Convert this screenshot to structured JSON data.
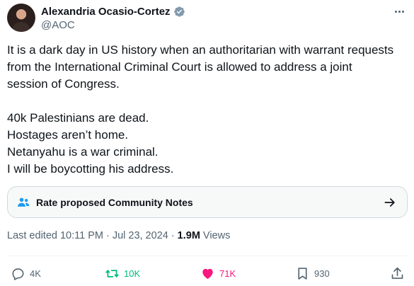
{
  "author": {
    "display_name": "Alexandria Ocasio-Cortez",
    "handle": "@AOC",
    "verified_color": "#829aab"
  },
  "tweet": {
    "paragraph_1": [
      "It is a dark day in US history when an authoritarian with warrant requests",
      "from the International Criminal Court is allowed to address a joint",
      "session of Congress."
    ],
    "paragraph_2": [
      "40k Palestinians are dead.",
      "Hostages aren’t home.",
      "Netanyahu is a war criminal.",
      "I will be boycotting his address."
    ]
  },
  "community_notes": {
    "label": "Rate proposed Community Notes",
    "icon": "people-icon",
    "icon_color": "#1d9bf0"
  },
  "meta": {
    "edited": "Last edited 10:11 PM",
    "separator": "·",
    "date": "Jul 23, 2024",
    "views_count": "1.9M",
    "views_label": "Views"
  },
  "actions": {
    "reply_count": "4K",
    "retweet_count": "10K",
    "like_count": "71K",
    "bookmark_count": "930",
    "retweet_color": "#00ba7c",
    "like_color": "#f91880"
  }
}
